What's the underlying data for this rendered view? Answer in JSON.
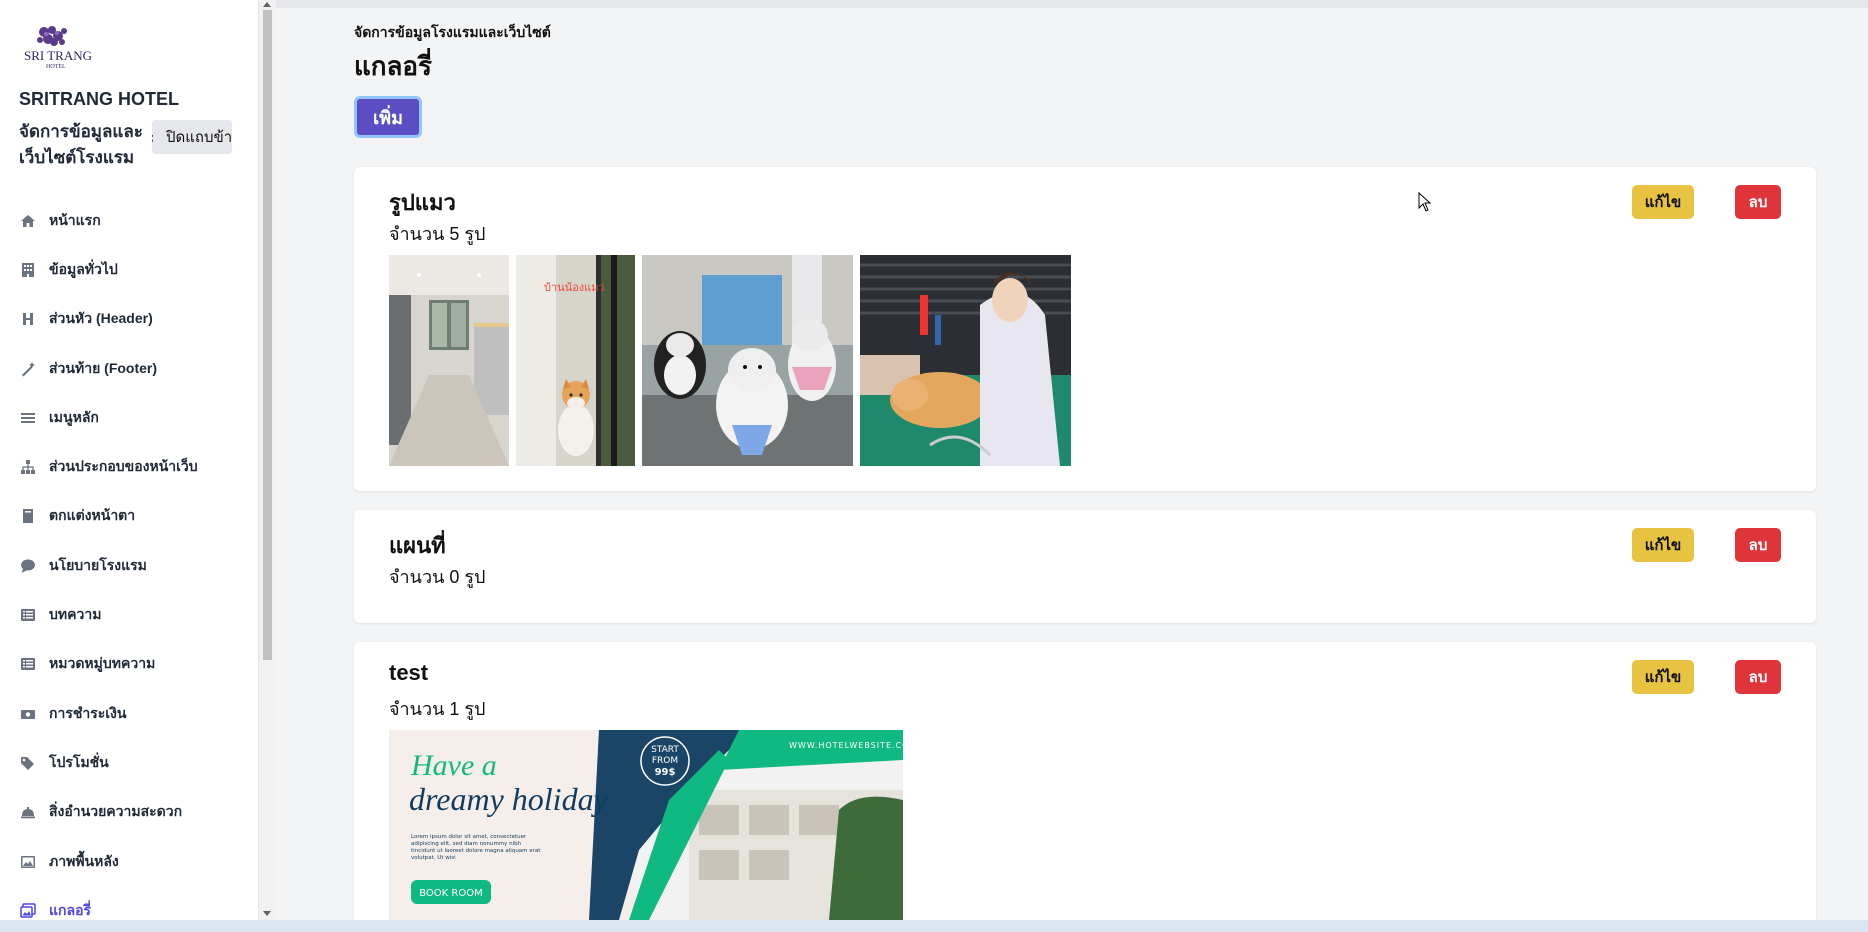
{
  "sidebar": {
    "logo_text": "SRI TRANG",
    "logo_sub": "HOTEL",
    "hotel_name": "SRITRANG HOTEL",
    "subtitle": "จัดการข้อมูลและเว็บไซต์โรงแรม",
    "collapse_label": "ปิดแถบข้าง",
    "items": [
      {
        "label": "หน้าแรก",
        "icon": "home-icon"
      },
      {
        "label": "ข้อมูลทั่วไป",
        "icon": "building-icon"
      },
      {
        "label": "ส่วนหัว (Header)",
        "icon": "heading-icon"
      },
      {
        "label": "ส่วนท้าย (Footer)",
        "icon": "magic-wand-icon"
      },
      {
        "label": "เมนูหลัก",
        "icon": "bars-icon"
      },
      {
        "label": "ส่วนประกอบของหน้าเว็บ",
        "icon": "sitemap-icon"
      },
      {
        "label": "ตกแต่งหน้าตา",
        "icon": "book-icon"
      },
      {
        "label": "นโยบายโรงแรม",
        "icon": "comment-icon"
      },
      {
        "label": "บทความ",
        "icon": "list-icon"
      },
      {
        "label": "หมวดหมู่บทความ",
        "icon": "list-alt-icon"
      },
      {
        "label": "การชำระเงิน",
        "icon": "money-icon"
      },
      {
        "label": "โปรโมชั่น",
        "icon": "tags-icon"
      },
      {
        "label": "สิ่งอำนวยความสะดวก",
        "icon": "bell-service-icon"
      },
      {
        "label": "ภาพพื้นหลัง",
        "icon": "image-icon"
      },
      {
        "label": "แกลอรี่",
        "icon": "images-icon"
      }
    ],
    "active_index": 14,
    "accent_color": "#4f46e5"
  },
  "header": {
    "breadcrumb": "จัดการข้อมูลโรงแรมและเว็บไซต์",
    "title": "แกลอรี่",
    "add_label": "เพิ่ม"
  },
  "galleries": [
    {
      "name": "รูปแมว",
      "count_text": "จำนวน 5 รูป",
      "edit_label": "แก้ไข",
      "delete_label": "ลบ"
    },
    {
      "name": "แผนที่",
      "count_text": "จำนวน 0 รูป",
      "edit_label": "แก้ไข",
      "delete_label": "ลบ"
    },
    {
      "name": "test",
      "count_text": "จำนวน 1 รูป",
      "edit_label": "แก้ไข",
      "delete_label": "ลบ"
    }
  ],
  "banner": {
    "line1": "Have a",
    "line2": "dreamy holiday",
    "start": "START",
    "from": "FROM",
    "price": "99$",
    "website": "WWW.HOTELWEBSITE.COM",
    "lorem": "Lorem ipsum dolor sit amet, consectetuer adipiscing elit, sed diam nonummy nibh tincidunt ut laoreet dolore magna aliquam erat volutpat. Ut wisi",
    "book": "BOOK ROOM"
  },
  "thumb_text": "บ้านน้องแมว",
  "colors": {
    "primary": "#5b4ec2",
    "edit": "#e8c341",
    "delete": "#e0343b",
    "banner_teal": "#10b981",
    "banner_navy": "#0f3b5f"
  }
}
